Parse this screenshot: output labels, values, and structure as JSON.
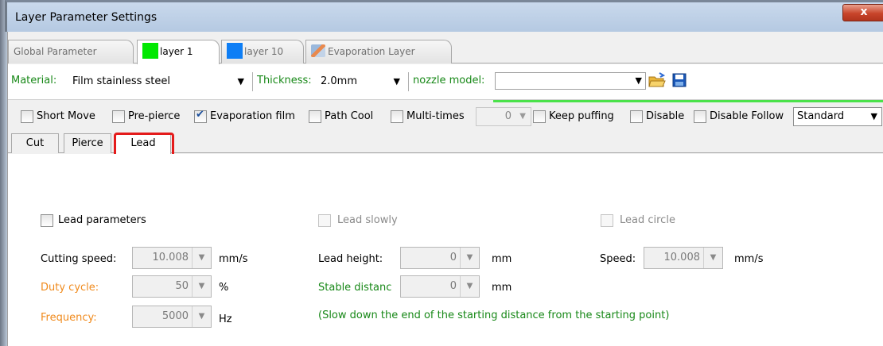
{
  "window": {
    "title": "Layer Parameter Settings",
    "close_label": "x"
  },
  "layer_tabs": [
    {
      "label": "Global Parameter"
    },
    {
      "label": "layer 1",
      "color": "#00e800"
    },
    {
      "label": "layer 10",
      "color": "#0e7ef5"
    },
    {
      "label": "Evaporation Layer"
    }
  ],
  "material_row": {
    "material_label": "Material:",
    "material_value": "Film stainless steel",
    "thickness_label": "Thickness:",
    "thickness_value": "2.0mm",
    "nozzle_label": "nozzle model:",
    "nozzle_value": ""
  },
  "options": {
    "short_move": "Short Move",
    "pre_pierce": "Pre-pierce",
    "evaporation_film": "Evaporation film",
    "path_cool": "Path Cool",
    "multi_times": "Multi-times",
    "multi_times_value": "0",
    "keep_puffing": "Keep puffing",
    "disable": "Disable",
    "disable_follow": "Disable Follow",
    "mode_value": "Standard",
    "evaporation_checked": true
  },
  "sub_tabs": [
    {
      "label": "Cut"
    },
    {
      "label": "Pierce"
    },
    {
      "label": "Lead"
    }
  ],
  "lead_panel": {
    "lead_parameters": "Lead parameters",
    "lead_slowly": "Lead slowly",
    "lead_circle": "Lead circle",
    "cutting_speed_label": "Cutting speed:",
    "cutting_speed_value": "10.008",
    "cutting_speed_unit": "mm/s",
    "duty_cycle_label": "Duty cycle:",
    "duty_cycle_value": "50",
    "duty_cycle_unit": "%",
    "frequency_label": "Frequency:",
    "frequency_value": "5000",
    "frequency_unit": "Hz",
    "lead_height_label": "Lead height:",
    "lead_height_value": "0",
    "lead_height_unit": "mm",
    "stable_distance_label": "Stable distanc",
    "stable_distance_value": "0",
    "stable_distance_unit": "mm",
    "speed_label": "Speed:",
    "speed_value": "10.008",
    "speed_unit": "mm/s",
    "note": "(Slow down the end of the starting distance from the starting point)"
  },
  "colors": {
    "orange": "#f08a1c",
    "green": "#178817",
    "highlight": "#e41b1b"
  }
}
